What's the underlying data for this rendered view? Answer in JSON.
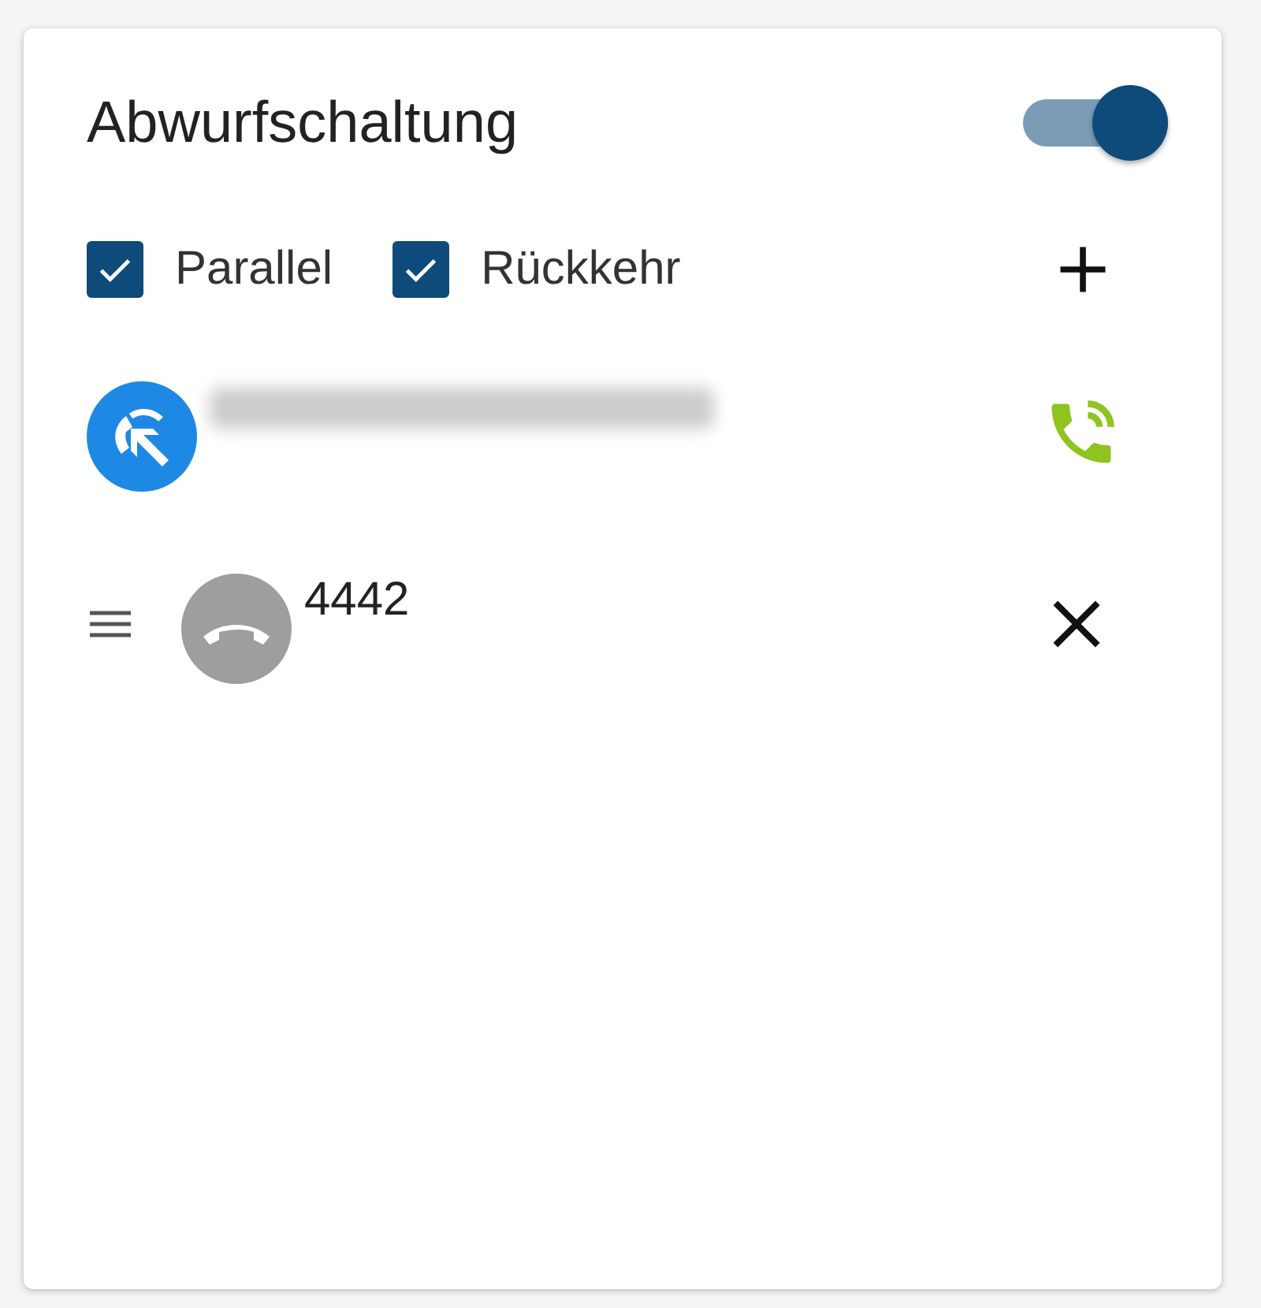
{
  "card": {
    "title": "Abwurfschaltung",
    "enabled": true
  },
  "options": [
    {
      "label": "Parallel",
      "checked": true
    },
    {
      "label": "Rückkehr",
      "checked": true
    }
  ],
  "entries": [
    {
      "kind": "source",
      "redacted": true
    },
    {
      "kind": "target",
      "number": "4442"
    }
  ]
}
